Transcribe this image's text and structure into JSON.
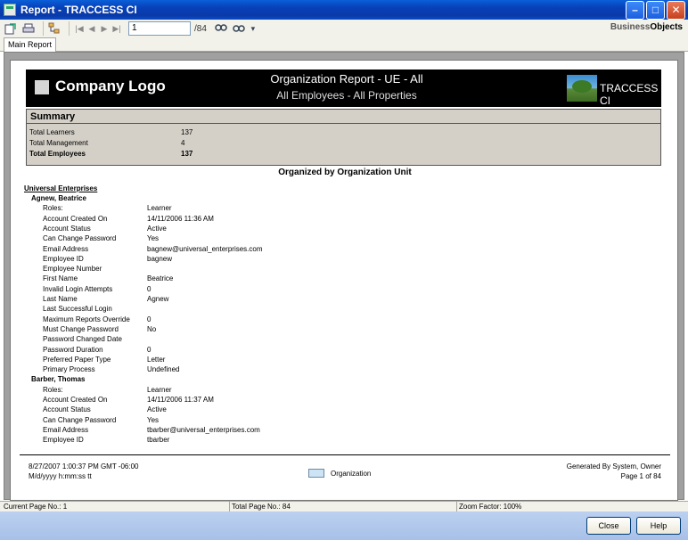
{
  "window": {
    "title": "Report - TRACCESS CI",
    "controls": {
      "minimize": "–",
      "maximize": "□",
      "close": "✕"
    }
  },
  "toolbar": {
    "icons": [
      "export-icon",
      "print-icon",
      "group-tree-icon",
      "first-page-icon",
      "prev-page-icon",
      "next-page-icon",
      "last-page-icon",
      "search-icon",
      "zoom-icon"
    ],
    "page_value": "1",
    "page_total": "/84",
    "zoom_arrow": "▾",
    "brand_a": "Business",
    "brand_b": "Objects"
  },
  "tabs": [
    {
      "label": "Main Report"
    }
  ],
  "report": {
    "logo_text": "Company Logo",
    "title": "Organization Report - UE - All",
    "subtitle": "All Employees - All Properties",
    "brand": "TRACCESS CI",
    "summary": {
      "heading": "Summary",
      "rows": [
        {
          "label": "Total Learners",
          "value": "137"
        },
        {
          "label": "Total Management",
          "value": "4"
        },
        {
          "label": "Total Employees",
          "value": "137"
        }
      ]
    },
    "organized_by": "Organized by Organization Unit",
    "org_unit": "Universal Enterprises",
    "people": [
      {
        "name": "Agnew, Beatrice",
        "fields": [
          {
            "label": "Roles:",
            "value": "Learner"
          },
          {
            "label": "Account Created On",
            "value": "14/11/2006 11:36 AM"
          },
          {
            "label": "Account Status",
            "value": "Active"
          },
          {
            "label": "Can Change Password",
            "value": "Yes"
          },
          {
            "label": "Email Address",
            "value": "bagnew@universal_enterprises.com"
          },
          {
            "label": "Employee ID",
            "value": "bagnew"
          },
          {
            "label": "Employee Number",
            "value": ""
          },
          {
            "label": "First Name",
            "value": "Beatrice"
          },
          {
            "label": "Invalid Login Attempts",
            "value": "0"
          },
          {
            "label": "Last Name",
            "value": "Agnew"
          },
          {
            "label": "Last Successful Login",
            "value": ""
          },
          {
            "label": "Maximum Reports Override",
            "value": "0"
          },
          {
            "label": "Must Change Password",
            "value": "No"
          },
          {
            "label": "Password Changed Date",
            "value": ""
          },
          {
            "label": "Password Duration",
            "value": "0"
          },
          {
            "label": "Preferred Paper Type",
            "value": "Letter"
          },
          {
            "label": "Primary Process",
            "value": "Undefined"
          }
        ]
      },
      {
        "name": "Barber, Thomas",
        "fields": [
          {
            "label": "Roles:",
            "value": "Learner"
          },
          {
            "label": "Account Created On",
            "value": "14/11/2006 11:37 AM"
          },
          {
            "label": "Account Status",
            "value": "Active"
          },
          {
            "label": "Can Change Password",
            "value": "Yes"
          },
          {
            "label": "Email Address",
            "value": "tbarber@universal_enterprises.com"
          },
          {
            "label": "Employee ID",
            "value": "tbarber"
          }
        ]
      }
    ],
    "footer": {
      "datetime": "8/27/2007  1:00:37 PM GMT -06:00",
      "format": "M/d/yyyy h:mm:ss tt",
      "legend": "Organization",
      "generated_by": "Generated By System, Owner",
      "page_of": "Page 1 of 84"
    }
  },
  "status": {
    "current_page": "Current Page No.: 1",
    "total_page": "Total Page No.: 84",
    "zoom": "Zoom Factor: 100%"
  },
  "buttons": {
    "close": "Close",
    "help": "Help"
  }
}
